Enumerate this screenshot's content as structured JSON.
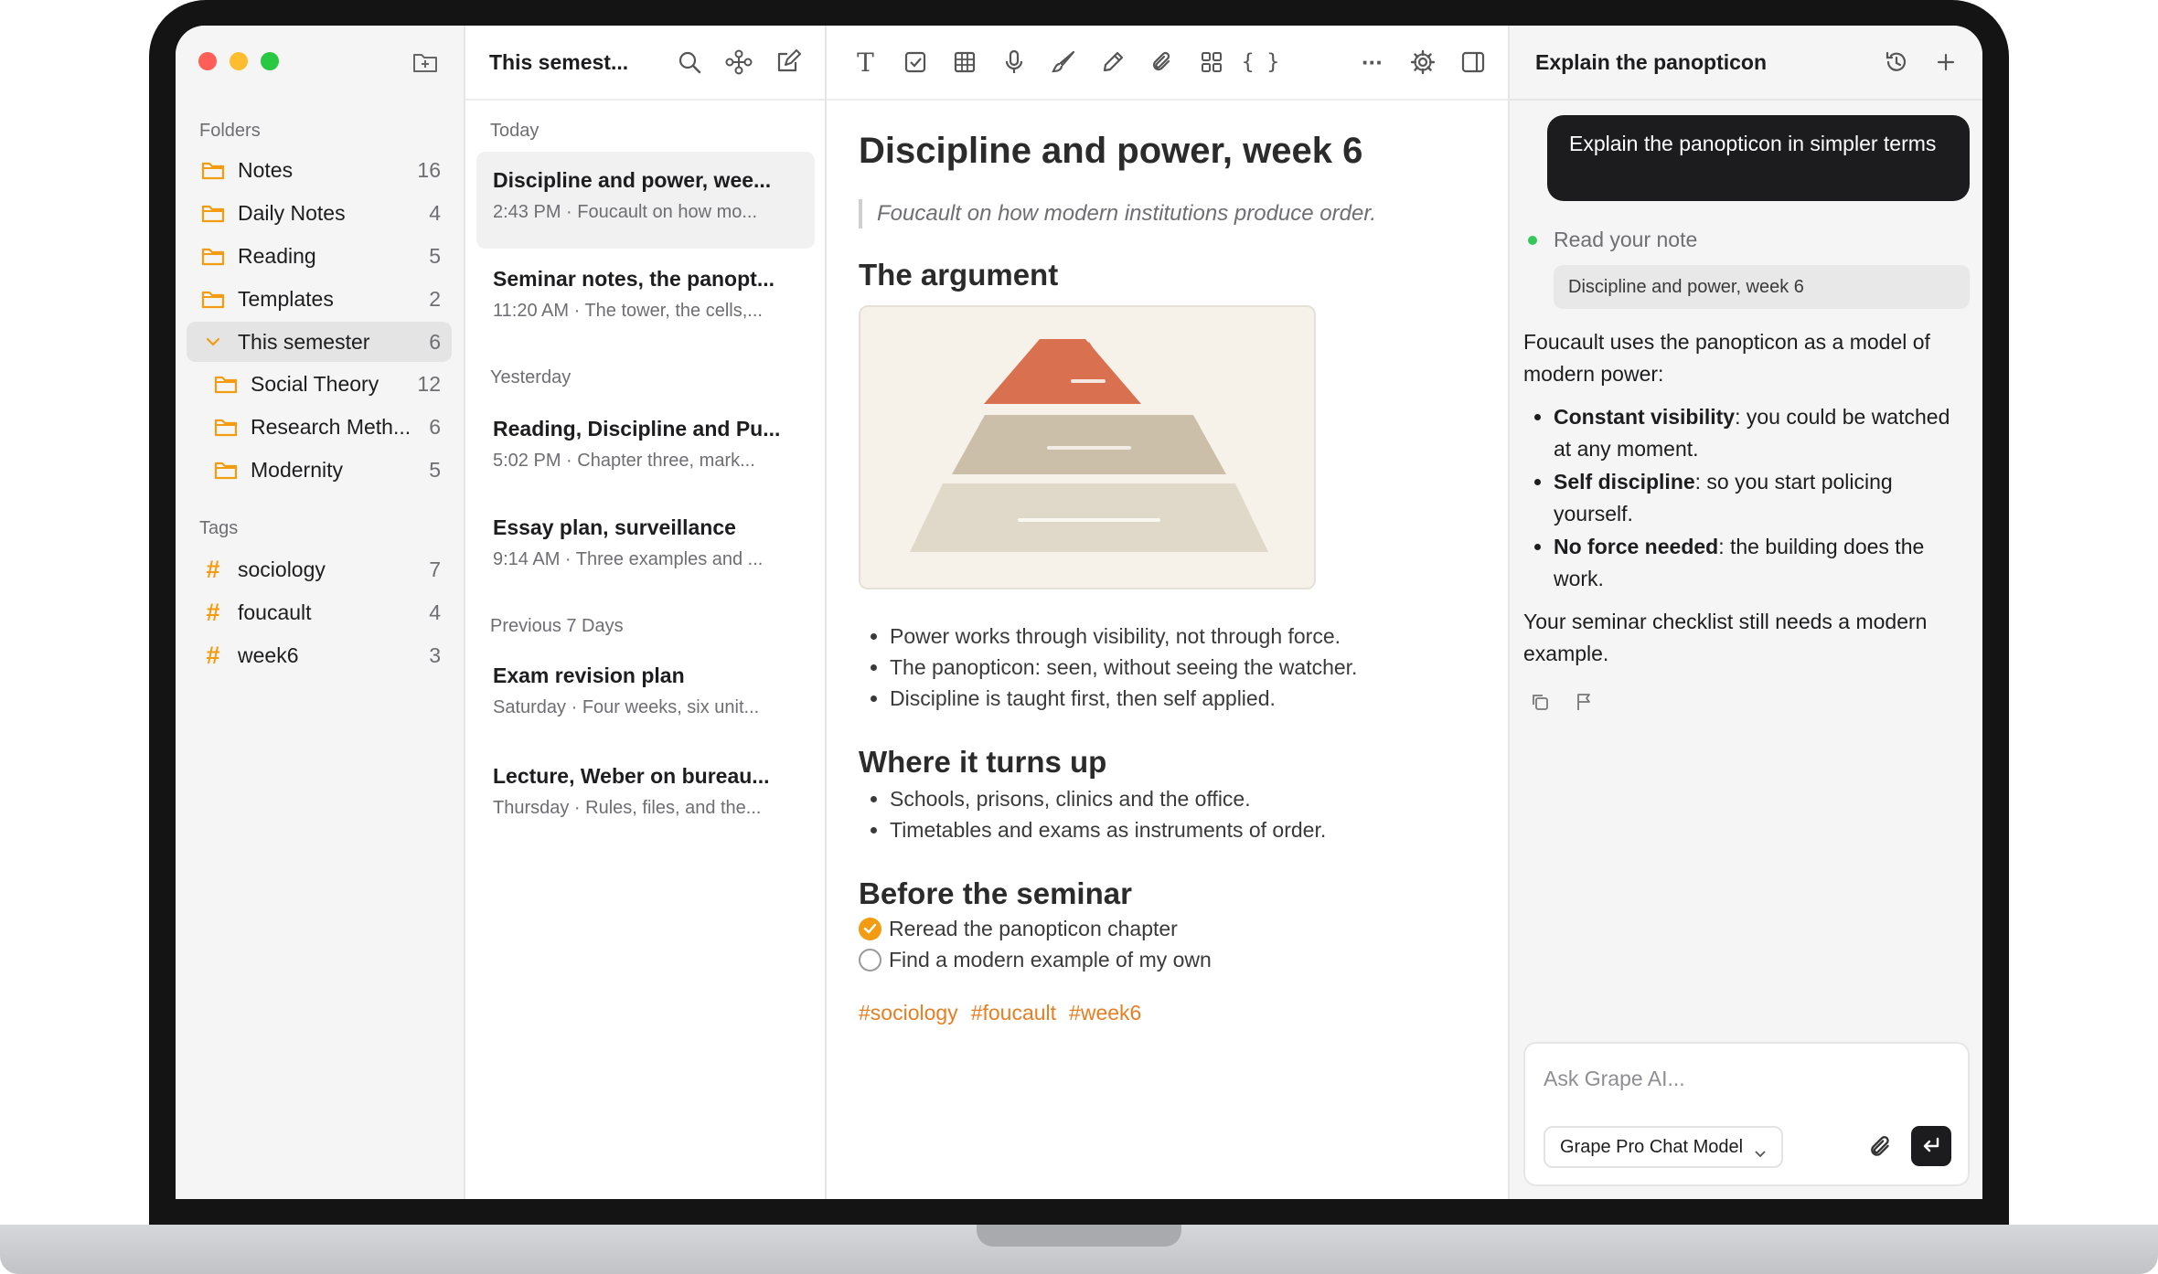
{
  "sidebar": {
    "folders_label": "Folders",
    "folders": [
      {
        "label": "Notes",
        "count": "16"
      },
      {
        "label": "Daily Notes",
        "count": "4"
      },
      {
        "label": "Reading",
        "count": "5"
      },
      {
        "label": "Templates",
        "count": "2"
      },
      {
        "label": "This semester",
        "count": "6"
      },
      {
        "label": "Social Theory",
        "count": "12"
      },
      {
        "label": "Research Meth...",
        "count": "6"
      },
      {
        "label": "Modernity",
        "count": "5"
      }
    ],
    "tags_label": "Tags",
    "tags": [
      {
        "label": "sociology",
        "count": "7"
      },
      {
        "label": "foucault",
        "count": "4"
      },
      {
        "label": "week6",
        "count": "3"
      }
    ]
  },
  "list": {
    "title": "This semest...",
    "groups": {
      "today": "Today",
      "yesterday": "Yesterday",
      "previous": "Previous 7 Days"
    },
    "notes": [
      {
        "title": "Discipline and power, wee...",
        "meta": "2:43 PM · Foucault on how mo..."
      },
      {
        "title": "Seminar notes, the panopt...",
        "meta": "11:20 AM · The tower, the cells,..."
      },
      {
        "title": "Reading, Discipline and Pu...",
        "meta": "5:02 PM · Chapter three, mark..."
      },
      {
        "title": "Essay plan, surveillance",
        "meta": "9:14 AM · Three examples and ..."
      },
      {
        "title": "Exam revision plan",
        "meta": "Saturday · Four weeks, six unit..."
      },
      {
        "title": "Lecture, Weber on bureau...",
        "meta": "Thursday · Rules, files, and the..."
      }
    ]
  },
  "editor": {
    "toolbar": {
      "text_glyph": "T",
      "code_glyph": "{ }",
      "more_glyph": "···"
    },
    "title": "Discipline and power, week 6",
    "quote": "Foucault on how modern institutions produce order.",
    "h_argument": "The argument",
    "argument_bullets": [
      "Power works through visibility, not through force.",
      "The panopticon: seen, without seeing the watcher.",
      "Discipline is taught first, then self applied."
    ],
    "h_where": "Where it turns up",
    "where_bullets": [
      "Schools, prisons, clinics and the office.",
      "Timetables and exams as instruments of order."
    ],
    "h_before": "Before the seminar",
    "checklist": [
      {
        "label": "Reread the panopticon chapter",
        "done": true
      },
      {
        "label": "Find a modern example of my own",
        "done": false
      }
    ],
    "tags": [
      "#sociology",
      "#foucault",
      "#week6"
    ]
  },
  "ai": {
    "title": "Explain the panopticon",
    "user_message": "Explain the panopticon in simpler terms",
    "step_label": "Read your note",
    "ref_chip": "Discipline and power, week 6",
    "answer_intro": "Foucault uses the panopticon as a model of modern power:",
    "answer_points": [
      {
        "bold": "Constant visibility",
        "rest": ": you could be watched at any moment."
      },
      {
        "bold": "Self discipline",
        "rest": ": so you start policing yourself."
      },
      {
        "bold": "No force needed",
        "rest": ": the building does the work."
      }
    ],
    "answer_outro": "Your seminar checklist still needs a modern example.",
    "composer_placeholder": "Ask Grape AI...",
    "model_label": "Grape Pro Chat Model"
  },
  "colors": {
    "accent_orange": "#f39c12",
    "tag_orange": "#e67e22",
    "close": "#ff5f57",
    "minimize": "#febc2e",
    "zoom": "#28c840",
    "pyramid_top": "#d9704f",
    "pyramid_mid": "#cbbfa9",
    "pyramid_base": "#e0d8c8"
  }
}
